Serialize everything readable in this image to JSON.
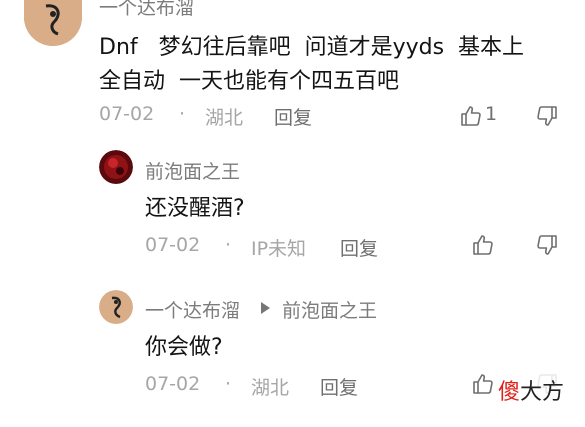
{
  "comments": [
    {
      "author": "一个达布溜",
      "text_line1": "Dnf   梦幻往后靠吧  问道才是yyds  基本上",
      "text_line2": "全自动  一天也能有个四五百吧",
      "date": "07-02",
      "dot": "·",
      "location": "湖北",
      "reply_label": "回复",
      "like_count": "1"
    },
    {
      "author": "前泡面之王",
      "text": "还没醒酒?",
      "date": "07-02",
      "dot": "·",
      "location": "IP未知",
      "reply_label": "回复"
    },
    {
      "author": "一个达布溜",
      "reply_to": "前泡面之王",
      "text": "你会做?",
      "date": "07-02",
      "dot": "·",
      "location": "湖北",
      "reply_label": "回复"
    }
  ],
  "icons": {
    "like": "thumbs-up-icon",
    "dislike": "thumbs-down-icon",
    "reply_arrow": "triangle-right-icon"
  },
  "watermark": {
    "char1": "傻",
    "chars_rest": "大方",
    "accent_color": "#e0201b",
    "text_color": "#222222"
  },
  "colors": {
    "name": "#7c7c7c",
    "meta": "#a6a6a6",
    "body": "#141414"
  }
}
